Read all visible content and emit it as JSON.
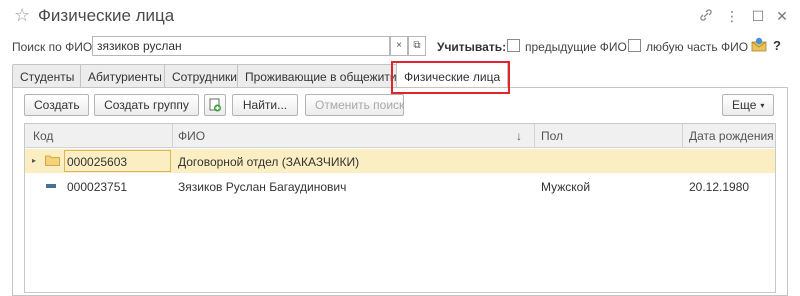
{
  "window": {
    "title": "Физические лица",
    "star_icon": "☆",
    "link_icon": "🔗",
    "menu_icon": "⋮",
    "restore_icon": "☐",
    "close_icon": "✕"
  },
  "search": {
    "label": "Поиск по ФИО:",
    "value": "зязиков руслан",
    "clear_icon": "×",
    "open_icon": "⧉",
    "consider_label": "Учитывать:",
    "previous_fio_label": "предыдущие ФИО",
    "previous_fio_checked": false,
    "any_part_label": "любую часть ФИО",
    "any_part_checked": false,
    "help_label": "?"
  },
  "tabs": [
    {
      "label": "Студенты",
      "active": false
    },
    {
      "label": "Абитуриенты",
      "active": false
    },
    {
      "label": "Сотрудники",
      "active": false
    },
    {
      "label": "Проживающие в общежитии",
      "active": false
    },
    {
      "label": "Физические лица",
      "active": true
    }
  ],
  "toolbar": {
    "create_label": "Создать",
    "create_group_label": "Создать группу",
    "find_label": "Найти...",
    "cancel_search_label": "Отменить поиск",
    "more_label": "Еще",
    "more_arrow": "▾"
  },
  "table": {
    "columns": [
      "Код",
      "ФИО",
      "Пол",
      "Дата рождения"
    ],
    "sort_indicator": "↓",
    "rows": [
      {
        "type": "group",
        "expand": "▸",
        "code": "000025603",
        "fio": "Договорной отдел (ЗАКАЗЧИКИ)",
        "gender": "",
        "birth_date": ""
      },
      {
        "type": "item",
        "code": "000023751",
        "fio": "Зязиков Руслан Багаудинович",
        "gender": "Мужской",
        "birth_date": "20.12.1980"
      }
    ]
  },
  "colors": {
    "highlight_border": "#e0262b",
    "selected_row": "#fbeec2",
    "header_bg": "#f0f0f0"
  }
}
